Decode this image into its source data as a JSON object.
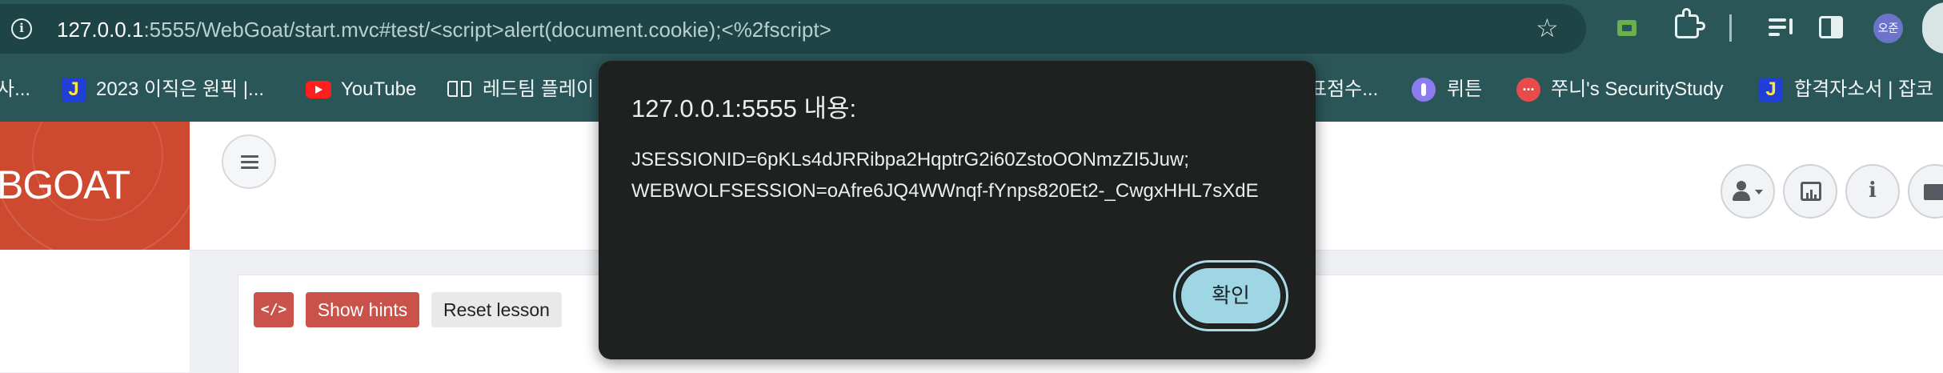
{
  "browser": {
    "url": {
      "host": "127.0.0.1",
      "rest": ":5555/WebGoat/start.mvc#test/<script>alert(document.cookie);<%2fscript>"
    },
    "profile_initials": "오준"
  },
  "bookmarks": [
    {
      "label": "사...",
      "icon": "partial-bookmark"
    },
    {
      "label": "2023 이직은 원픽 |...",
      "icon": "jira-icon"
    },
    {
      "label": "YouTube",
      "icon": "youtube-icon"
    },
    {
      "label": "레드팀 플레이",
      "icon": "book-icon"
    },
    {
      "label": "표점수...",
      "icon": "partial-bookmark"
    },
    {
      "label": "뤼튼",
      "icon": "wrtn-icon"
    },
    {
      "label": "쭈니's SecurityStudy",
      "icon": "jun-icon"
    },
    {
      "label": "합격자소서 | 잡코",
      "icon": "jira-icon"
    }
  ],
  "app": {
    "brand": "BGOAT",
    "toolbar": {
      "code_icon": "</>",
      "show_hints": "Show hints",
      "reset_lesson": "Reset lesson"
    },
    "header_icons": {
      "info": "i"
    }
  },
  "dialog": {
    "title": "127.0.0.1:5555 내용:",
    "line1": "JSESSIONID=6pKLs4dJRRibpa2HqptrG2i60ZstoOONmzZI5Juw;",
    "line2": "WEBWOLFSESSION=oAfre6JQ4WWnqf-fYnps820Et2-_CwgxHHL7sXdE",
    "ok_label": "확인"
  },
  "colors": {
    "chrome": "#2b5658",
    "omnibox": "#1f4446",
    "brand": "#cd4a30",
    "danger_button": "#c9524a",
    "dialog_bg": "#1e2120",
    "ok_button": "#9fd6e3"
  }
}
